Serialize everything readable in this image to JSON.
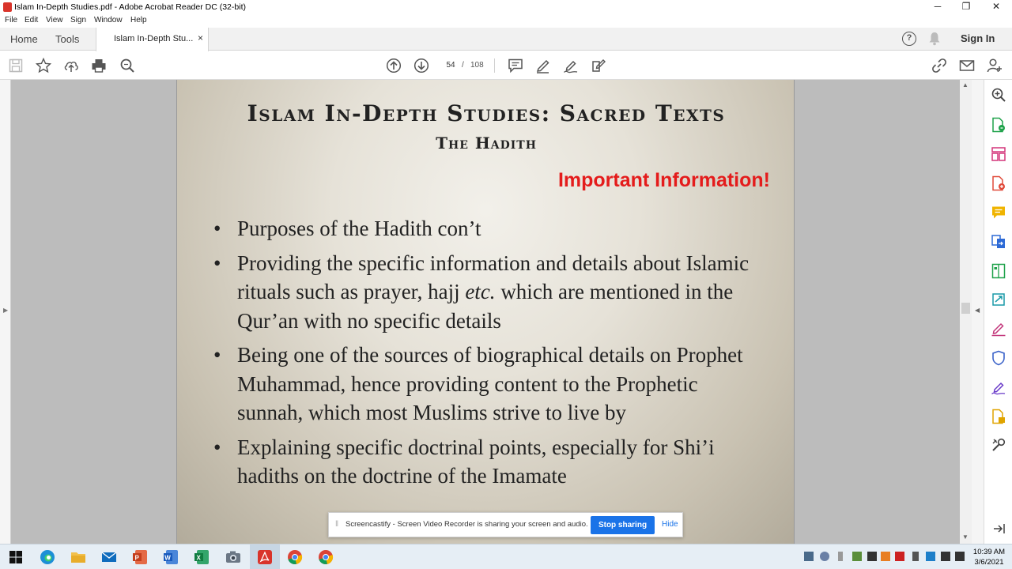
{
  "window": {
    "title": "Islam In-Depth Studies.pdf - Adobe Acrobat Reader DC (32-bit)",
    "minimize_glyph": "─",
    "restore_glyph": "❐",
    "close_glyph": "✕"
  },
  "menu": [
    "File",
    "Edit",
    "View",
    "Sign",
    "Window",
    "Help"
  ],
  "tabs": {
    "home": "Home",
    "tools": "Tools",
    "document": "Islam In-Depth Stu...",
    "document_close": "×",
    "help": "?",
    "signin": "Sign In"
  },
  "toolbar": {
    "current_page": "54",
    "separator": "/",
    "total_pages": "108"
  },
  "slide": {
    "title": "Islam In-Depth Studies: Sacred Texts",
    "subtitle": "The Hadith",
    "notice": "Important Information!",
    "bullets": [
      {
        "text": "Purposes of the Hadith con’t"
      },
      {
        "text": "Providing the specific information and details about Islamic rituals such as prayer, hajj",
        "italic": "etc.",
        "after": " which are mentioned in the Qur’an with no specific details"
      },
      {
        "text": "Being one of the sources of biographical details on Prophet Muhammad, hence providing content to the Prophetic sunnah, which most Muslims strive to live by"
      },
      {
        "text": "Explaining specific doctrinal points, especially for Shi’i hadiths on the doctrine of the Imamate"
      }
    ]
  },
  "share_notice": {
    "message": "Screencastify - Screen Video Recorder is sharing your screen and audio.",
    "stop": "Stop sharing",
    "hide": "Hide"
  },
  "clock": {
    "time": "10:39 AM",
    "date": "3/6/2021"
  },
  "colors": {
    "important": "#e41c1c",
    "share_button": "#1a73e8",
    "acrobat_red": "#d9342b"
  }
}
